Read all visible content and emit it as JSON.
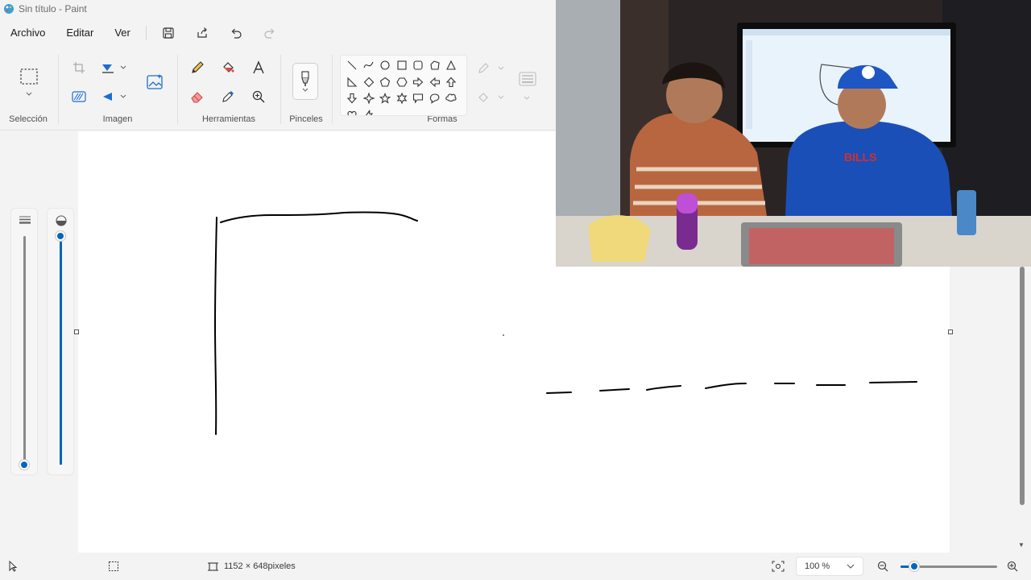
{
  "window": {
    "title": "Sin título - Paint"
  },
  "menu": {
    "file": "Archivo",
    "edit": "Editar",
    "view": "Ver"
  },
  "ribbon": {
    "groups": {
      "selection": "Selección",
      "image": "Imagen",
      "tools": "Herramientas",
      "brushes": "Pinceles",
      "shapes": "Formas"
    },
    "shapes": [
      "line-icon",
      "curve-icon",
      "oval-icon",
      "rectangle-icon",
      "rounded-rectangle-icon",
      "polygon-icon",
      "triangle-icon",
      "right-triangle-icon",
      "diamond-icon",
      "pentagon-icon",
      "hexagon-icon",
      "right-arrow-icon",
      "left-arrow-icon",
      "up-arrow-icon",
      "down-arrow-icon",
      "four-point-star-icon",
      "five-point-star-icon",
      "six-point-star-icon",
      "rect-callout-icon",
      "oval-callout-icon",
      "cloud-callout-icon",
      "heart-icon",
      "lightning-icon"
    ]
  },
  "status": {
    "canvas_size": "1152 × 648pixeles",
    "zoom": "100 %",
    "zoom_level": 0.14
  },
  "sliders": {
    "size_level": 0.0,
    "opacity_level": 1.0
  },
  "colors": {
    "accent": "#0067c0",
    "canvas": "#ffffff",
    "app_bg": "#f3f3f3"
  }
}
